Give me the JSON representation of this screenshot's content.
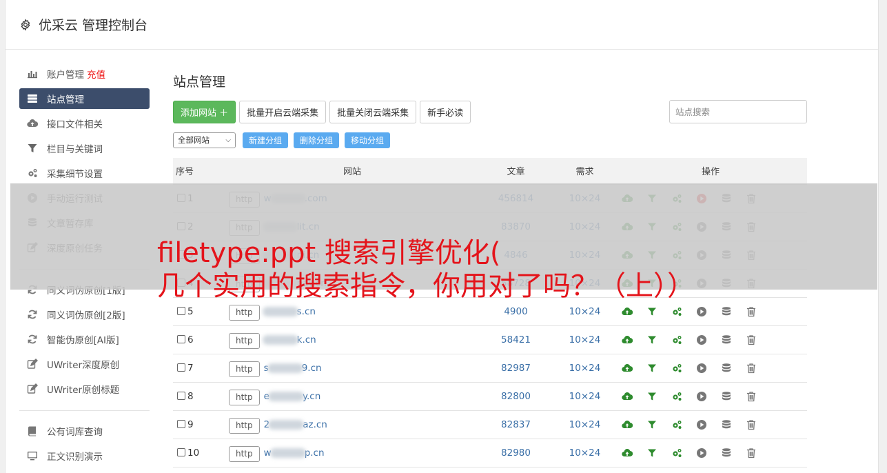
{
  "header": {
    "title": "优采云 管理控制台"
  },
  "sidebar": {
    "groups": [
      [
        {
          "label": "账户管理",
          "extra": "充值",
          "icon": "bar-chart-icon"
        },
        {
          "label": "站点管理",
          "icon": "server-icon",
          "active": true
        },
        {
          "label": "接口文件相关",
          "icon": "cloud-upload-icon"
        },
        {
          "label": "栏目与关键词",
          "icon": "filter-icon"
        },
        {
          "label": "采集细节设置",
          "icon": "gears-icon"
        },
        {
          "label": "手动运行测试",
          "icon": "play-icon"
        },
        {
          "label": "文章暂存库",
          "icon": "database-icon"
        },
        {
          "label": "深度原创任务",
          "icon": "edit-icon"
        }
      ],
      [
        {
          "label": "同义词伪原创[1版]",
          "icon": "refresh-icon"
        },
        {
          "label": "同义词伪原创[2版]",
          "icon": "refresh-icon"
        },
        {
          "label": "智能伪原创[AI版]",
          "icon": "refresh-icon"
        },
        {
          "label": "UWriter深度原创",
          "icon": "edit-icon"
        },
        {
          "label": "UWriter原创标题",
          "icon": "edit-icon"
        }
      ],
      [
        {
          "label": "公有词库查询",
          "icon": "book-icon"
        },
        {
          "label": "正文识别演示",
          "icon": "monitor-icon"
        }
      ]
    ]
  },
  "main": {
    "title": "站点管理",
    "toolbar": {
      "add_label": "添加网站 ＋",
      "batch_open_label": "批量开启云端采集",
      "batch_close_label": "批量关闭云端采集",
      "newbie_label": "新手必读",
      "search_placeholder": "站点搜索"
    },
    "group_select": "全部网站",
    "group_buttons": [
      "新建分组",
      "删除分组",
      "移动分组"
    ],
    "table": {
      "headers": [
        "序号",
        "网站",
        "文章",
        "需求",
        "操作"
      ],
      "rows": [
        {
          "id": "1",
          "prefix": "w",
          "suffix": ".com",
          "articles": "456814",
          "req": "10×24",
          "running": true
        },
        {
          "id": "2",
          "prefix": "",
          "suffix": "lit.cn",
          "articles": "83870",
          "req": "10×24"
        },
        {
          "id": "3",
          "prefix": "",
          "suffix": "ni.cn",
          "articles": "4846",
          "req": "10×24"
        },
        {
          "id": "4",
          "prefix": "",
          "suffix": "pay.cn",
          "articles": "58728",
          "req": "10×24"
        },
        {
          "id": "5",
          "prefix": "",
          "suffix": "s.cn",
          "articles": "4900",
          "req": "10×24"
        },
        {
          "id": "6",
          "prefix": "",
          "suffix": "k.cn",
          "articles": "58421",
          "req": "10×24"
        },
        {
          "id": "7",
          "prefix": "s",
          "suffix": "9.cn",
          "articles": "82987",
          "req": "10×24"
        },
        {
          "id": "8",
          "prefix": "e",
          "suffix": "y.cn",
          "articles": "82800",
          "req": "10×24"
        },
        {
          "id": "9",
          "prefix": "2",
          "suffix": "az.cn",
          "articles": "82837",
          "req": "10×24"
        },
        {
          "id": "10",
          "prefix": "w",
          "suffix": "p.cn",
          "articles": "82980",
          "req": "10×24"
        }
      ],
      "http_label": "http"
    }
  },
  "overlay": {
    "line1": "filetype:ppt 搜索引擎优化(",
    "line2": "几个实用的搜索指令，你用对了吗？（上））"
  },
  "colors": {
    "active_nav": "#3c4d6b",
    "green_btn": "#5cb85c",
    "link_blue": "#3a6fa7",
    "overlay_red": "#e4141b"
  }
}
